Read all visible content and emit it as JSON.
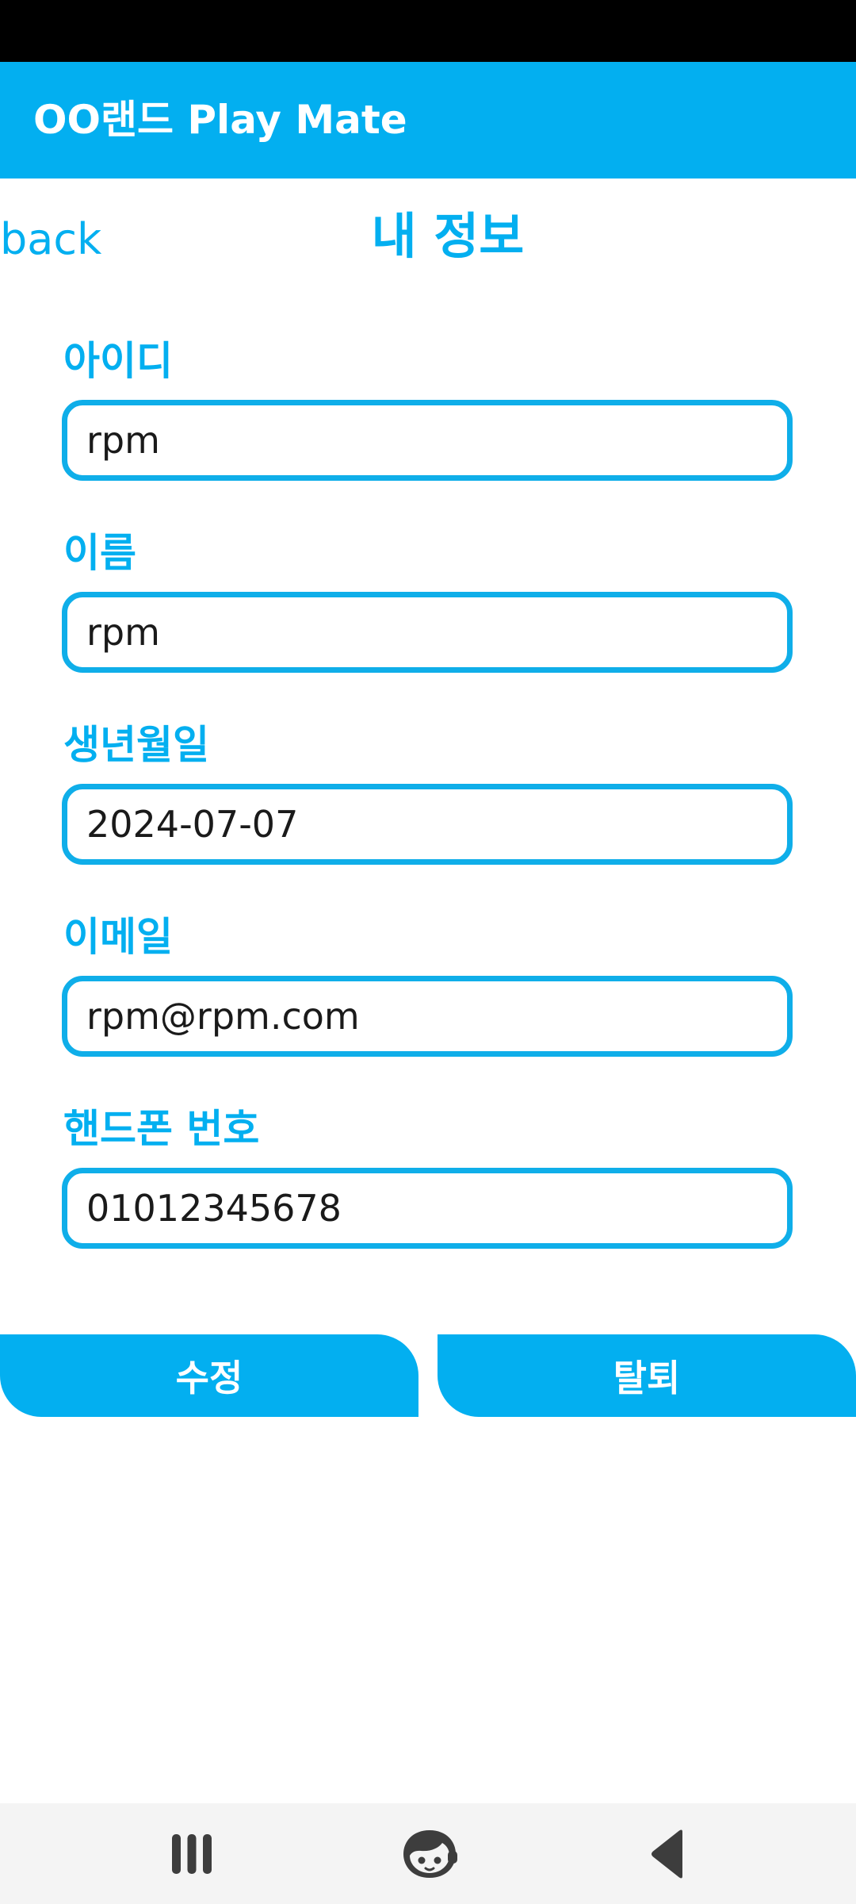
{
  "app": {
    "title": "OO랜드 Play Mate"
  },
  "header": {
    "back_label": "back",
    "page_title": "내 정보"
  },
  "form": {
    "fields": [
      {
        "label": "아이디",
        "value": "rpm"
      },
      {
        "label": "이름",
        "value": "rpm"
      },
      {
        "label": "생년월일",
        "value": "2024-07-07"
      },
      {
        "label": "이메일",
        "value": "rpm@rpm.com"
      },
      {
        "label": "핸드폰 번호",
        "value": "01012345678"
      }
    ]
  },
  "actions": {
    "edit_label": "수정",
    "withdraw_label": "탈퇴"
  },
  "colors": {
    "accent": "#03aff0",
    "status_bar": "#000000",
    "nav_bar": "#f4f4f4",
    "input_border": "#0faee9"
  },
  "nav": {
    "icons": [
      "recent-apps-icon",
      "home-icon",
      "back-icon"
    ]
  }
}
